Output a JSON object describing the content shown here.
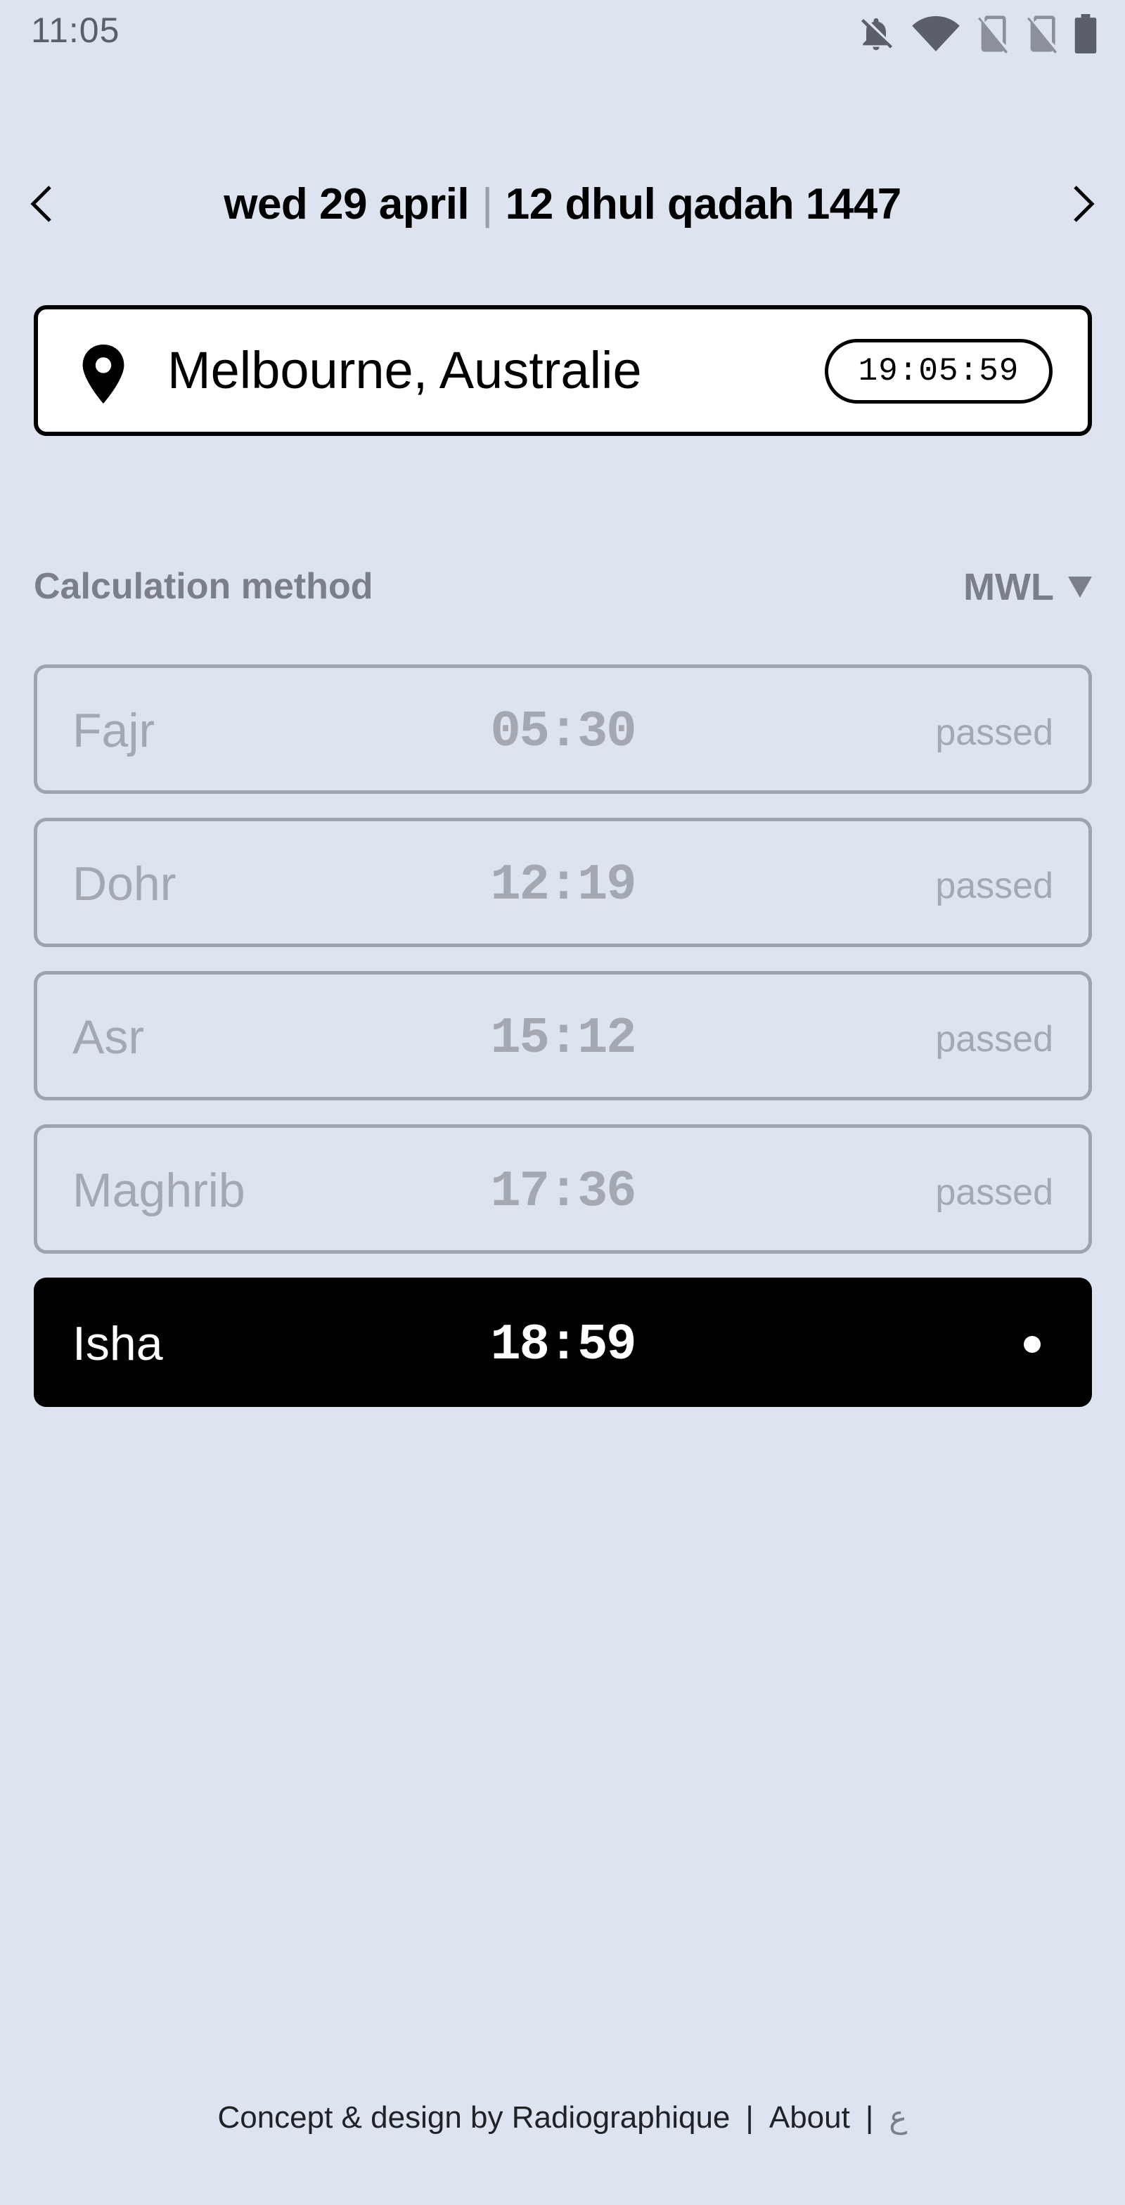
{
  "status_bar": {
    "time": "11:05",
    "icons": [
      "notifications-off-icon",
      "wifi-icon",
      "no-sim-icon",
      "no-sim-icon",
      "battery-icon"
    ]
  },
  "date_nav": {
    "gregorian": "wed 29 april",
    "separator": "|",
    "hijri": "12 dhul qadah 1447",
    "prev_icon": "chevron-left-icon",
    "next_icon": "chevron-right-icon"
  },
  "location": {
    "icon": "location-pin-icon",
    "name": "Melbourne, Australie",
    "clock": "19:05:59"
  },
  "calculation": {
    "label": "Calculation method",
    "value": "MWL",
    "icon": "caret-down-icon"
  },
  "prayers": [
    {
      "name": "Fajr",
      "time": "05:30",
      "status": "passed"
    },
    {
      "name": "Dohr",
      "time": "12:19",
      "status": "passed"
    },
    {
      "name": "Asr",
      "time": "15:12",
      "status": "passed"
    },
    {
      "name": "Maghrib",
      "time": "17:36",
      "status": "passed"
    },
    {
      "name": "Isha",
      "time": "18:59",
      "status": ""
    }
  ],
  "footer": {
    "credit": "Concept & design by Radiographique",
    "sep": "|",
    "about": "About",
    "language": "ع"
  },
  "colors": {
    "background": "#dde3ef",
    "active_row": "#000000",
    "passed_text": "#a3a8b1"
  }
}
